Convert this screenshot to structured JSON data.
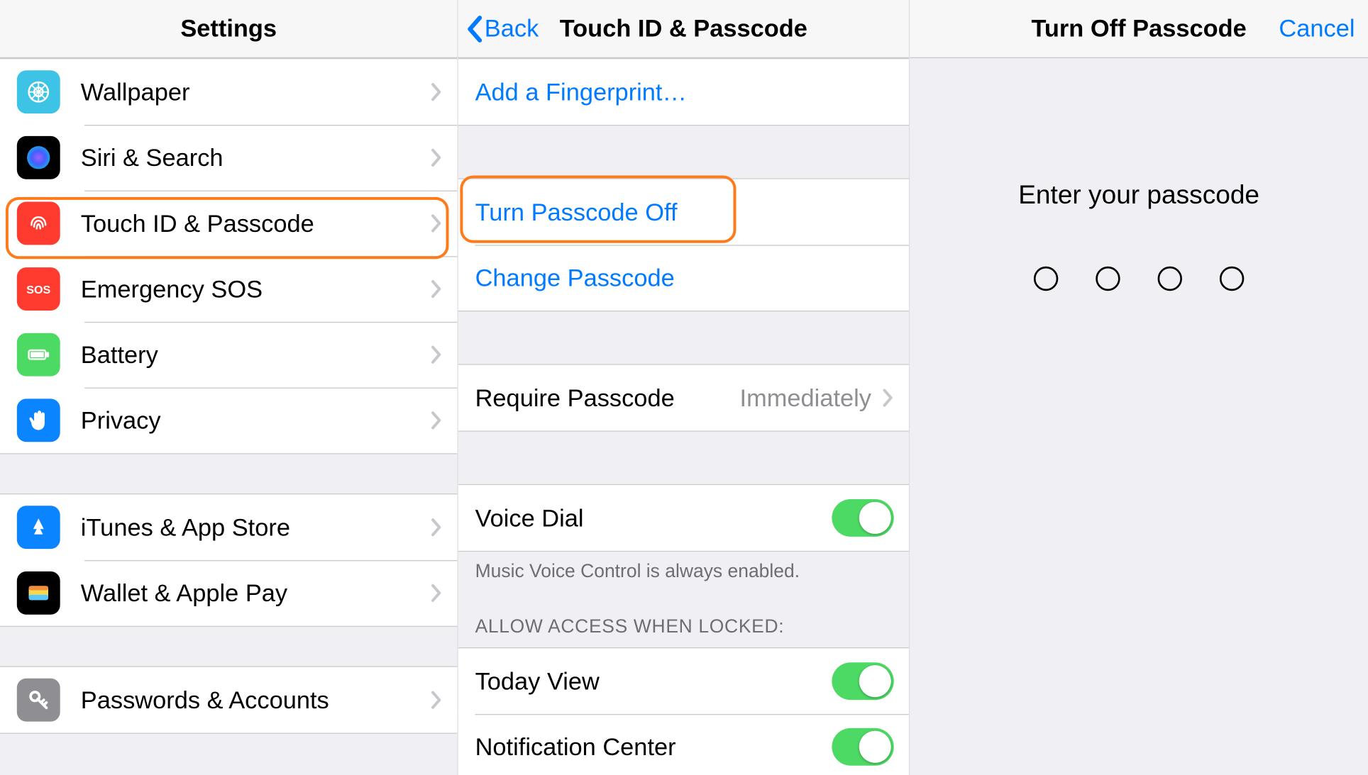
{
  "panel1": {
    "title": "Settings",
    "items_a": [
      {
        "label": "Wallpaper",
        "icon": "wallpaper",
        "bg": "bg-cyan"
      },
      {
        "label": "Siri & Search",
        "icon": "siri",
        "bg": "bg-black"
      },
      {
        "label": "Touch ID & Passcode",
        "icon": "fingerprint",
        "bg": "bg-red"
      },
      {
        "label": "Emergency SOS",
        "icon": "sos",
        "bg": "bg-red"
      },
      {
        "label": "Battery",
        "icon": "battery",
        "bg": "bg-green"
      },
      {
        "label": "Privacy",
        "icon": "hand",
        "bg": "bg-blue"
      }
    ],
    "items_b": [
      {
        "label": "iTunes & App Store",
        "icon": "appstore",
        "bg": "bg-blue"
      },
      {
        "label": "Wallet & Apple Pay",
        "icon": "wallet",
        "bg": "bg-black"
      }
    ],
    "items_c": [
      {
        "label": "Passwords & Accounts",
        "icon": "key",
        "bg": "bg-gray"
      }
    ]
  },
  "panel2": {
    "back": "Back",
    "title": "Touch ID & Passcode",
    "addFingerprint": "Add a Fingerprint…",
    "turnOff": "Turn Passcode Off",
    "change": "Change Passcode",
    "require": {
      "label": "Require Passcode",
      "value": "Immediately"
    },
    "voiceDial": "Voice Dial",
    "voiceFooter": "Music Voice Control is always enabled.",
    "allowHeader": "ALLOW ACCESS WHEN LOCKED:",
    "today": "Today View",
    "notif": "Notification Center"
  },
  "panel3": {
    "title": "Turn Off Passcode",
    "cancel": "Cancel",
    "prompt": "Enter your passcode"
  }
}
